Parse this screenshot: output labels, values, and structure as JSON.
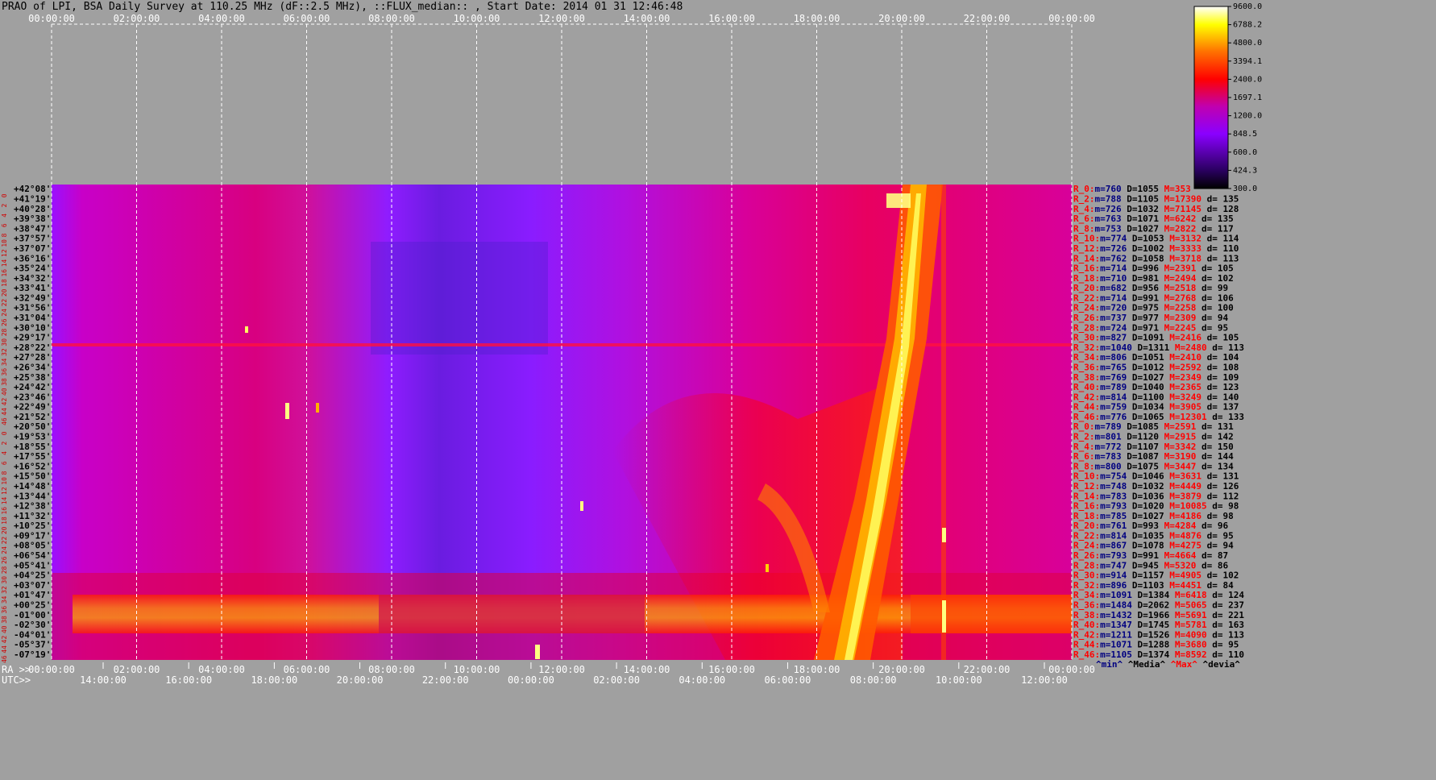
{
  "title": "PRAO of LPI, BSA Daily Survey at 110.25 MHz (dF::2.5 MHz), ::FLUX_median:: , Start Date: 2014 01 31 12:46:48",
  "chart_data": {
    "type": "heatmap",
    "title": "PRAO of LPI, BSA Daily Survey at 110.25 MHz (dF::2.5 MHz), ::FLUX_median:: , Start Date: 2014 01 31 12:46:48",
    "x_top_ticks": [
      "00:00:00",
      "02:00:00",
      "04:00:00",
      "06:00:00",
      "08:00:00",
      "10:00:00",
      "12:00:00",
      "14:00:00",
      "16:00:00",
      "18:00:00",
      "20:00:00",
      "22:00:00",
      "00:00:00"
    ],
    "x_top_label": "",
    "x_bottom_ra_prefix": "RA >>",
    "x_bottom_ra_ticks": [
      "00:00:00",
      "02:00:00",
      "04:00:00",
      "06:00:00",
      "08:00:00",
      "10:00:00",
      "12:00:00",
      "14:00:00",
      "16:00:00",
      "18:00:00",
      "20:00:00",
      "22:00:00",
      "00:00:00"
    ],
    "x_bottom_utc_prefix": "UTC>>",
    "x_bottom_utc_ticks": [
      "14:00:00",
      "16:00:00",
      "18:00:00",
      "20:00:00",
      "22:00:00",
      "00:00:00",
      "02:00:00",
      "04:00:00",
      "06:00:00",
      "08:00:00",
      "10:00:00",
      "12:00:00"
    ],
    "y_ticks": [
      "+42°08'",
      "+41°19'",
      "+40°28'",
      "+39°38'",
      "+38°47'",
      "+37°57'",
      "+37°07'",
      "+36°16'",
      "+35°24'",
      "+34°32'",
      "+33°41'",
      "+32°49'",
      "+31°56'",
      "+31°04'",
      "+30°10'",
      "+29°17'",
      "+28°22'",
      "+27°28'",
      "+26°34'",
      "+25°38'",
      "+24°42'",
      "+23°46'",
      "+22°49'",
      "+21°52'",
      "+20°50'",
      "+19°53'",
      "+18°55'",
      "+17°55'",
      "+16°52'",
      "+15°50'",
      "+14°48'",
      "+13°44'",
      "+12°38'",
      "+11°32'",
      "+10°25'",
      "+09°17'",
      "+08°05'",
      "+06°54'",
      "+05°41'",
      "+04°25'",
      "+03°07'",
      "+01°47'",
      "+00°25'",
      "-01°00'",
      "-02°30'",
      "-04°01'",
      "-05°37'",
      "-07°19'"
    ],
    "y_index_labels": [
      "0",
      "2",
      "4",
      "6",
      "8",
      "10",
      "12",
      "14",
      "16",
      "18",
      "20",
      "22",
      "24",
      "26",
      "28",
      "30",
      "32",
      "34",
      "36",
      "38",
      "40",
      "42",
      "44",
      "46",
      "0",
      "2",
      "4",
      "6",
      "8",
      "10",
      "12",
      "14",
      "16",
      "18",
      "20",
      "22",
      "24",
      "26",
      "28",
      "30",
      "32",
      "34",
      "36",
      "38",
      "40",
      "42",
      "44",
      "46"
    ],
    "colorbar": {
      "ticks": [
        9600.0,
        6788.2,
        4800.0,
        3394.1,
        2400.0,
        1697.1,
        1200.0,
        848.5,
        600.0,
        424.3,
        300.0
      ],
      "range": [
        300.0,
        9600.0
      ],
      "colors": [
        "#000000",
        "#3a0070",
        "#8a00ff",
        "#c000c0",
        "#ff0000",
        "#ff8000",
        "#ffff00",
        "#ffffff"
      ]
    },
    "stats_legend": {
      "min": "^min^",
      "median": "^Media^",
      "max": "^Max^",
      "dev": "^devia^"
    },
    "stats": [
      {
        "r": "R_0:",
        "m": "m=760",
        "D": "D=1055",
        "M": "M=353",
        "d": ""
      },
      {
        "r": "R_2:",
        "m": "m=788",
        "D": "D=1105",
        "M": "M=17390",
        "d": "d= 135"
      },
      {
        "r": "R_4:",
        "m": "m=726",
        "D": "D=1032",
        "M": "M=71145",
        "d": "d= 128"
      },
      {
        "r": "R_6:",
        "m": "m=763",
        "D": "D=1071",
        "M": "M=6242",
        "d": "d= 135"
      },
      {
        "r": "R_8:",
        "m": "m=753",
        "D": "D=1027",
        "M": "M=2822",
        "d": "d= 117"
      },
      {
        "r": "R_10:",
        "m": "m=774",
        "D": "D=1053",
        "M": "M=3132",
        "d": "d= 114"
      },
      {
        "r": "R_12:",
        "m": "m=726",
        "D": "D=1002",
        "M": "M=3333",
        "d": "d= 110"
      },
      {
        "r": "R_14:",
        "m": "m=762",
        "D": "D=1058",
        "M": "M=3718",
        "d": "d= 113"
      },
      {
        "r": "R_16:",
        "m": "m=714",
        "D": "D=996",
        "M": "M=2391",
        "d": "d= 105"
      },
      {
        "r": "R_18:",
        "m": "m=710",
        "D": "D=981",
        "M": "M=2494",
        "d": "d= 102"
      },
      {
        "r": "R_20:",
        "m": "m=682",
        "D": "D=956",
        "M": "M=2518",
        "d": "d= 99"
      },
      {
        "r": "R_22:",
        "m": "m=714",
        "D": "D=991",
        "M": "M=2768",
        "d": "d= 106"
      },
      {
        "r": "R_24:",
        "m": "m=720",
        "D": "D=975",
        "M": "M=2258",
        "d": "d= 100"
      },
      {
        "r": "R_26:",
        "m": "m=737",
        "D": "D=977",
        "M": "M=2309",
        "d": "d= 94"
      },
      {
        "r": "R_28:",
        "m": "m=724",
        "D": "D=971",
        "M": "M=2245",
        "d": "d= 95"
      },
      {
        "r": "R_30:",
        "m": "m=827",
        "D": "D=1091",
        "M": "M=2416",
        "d": "d= 105"
      },
      {
        "r": "R_32:",
        "m": "m=1040",
        "D": "D=1311",
        "M": "M=2480",
        "d": "d= 113"
      },
      {
        "r": "R_34:",
        "m": "m=806",
        "D": "D=1051",
        "M": "M=2410",
        "d": "d= 104"
      },
      {
        "r": "R_36:",
        "m": "m=765",
        "D": "D=1012",
        "M": "M=2592",
        "d": "d= 108"
      },
      {
        "r": "R_38:",
        "m": "m=769",
        "D": "D=1027",
        "M": "M=2349",
        "d": "d= 109"
      },
      {
        "r": "R_40:",
        "m": "m=789",
        "D": "D=1040",
        "M": "M=2365",
        "d": "d= 123"
      },
      {
        "r": "R_42:",
        "m": "m=814",
        "D": "D=1100",
        "M": "M=3249",
        "d": "d= 140"
      },
      {
        "r": "R_44:",
        "m": "m=759",
        "D": "D=1034",
        "M": "M=3905",
        "d": "d= 137"
      },
      {
        "r": "R_46:",
        "m": "m=776",
        "D": "D=1065",
        "M": "M=12301",
        "d": "d= 133"
      },
      {
        "r": "R_0:",
        "m": "m=789",
        "D": "D=1085",
        "M": "M=2591",
        "d": "d= 131"
      },
      {
        "r": "R_2:",
        "m": "m=801",
        "D": "D=1120",
        "M": "M=2915",
        "d": "d= 142"
      },
      {
        "r": "R_4:",
        "m": "m=772",
        "D": "D=1107",
        "M": "M=3342",
        "d": "d= 150"
      },
      {
        "r": "R_6:",
        "m": "m=783",
        "D": "D=1087",
        "M": "M=3190",
        "d": "d= 144"
      },
      {
        "r": "R_8:",
        "m": "m=800",
        "D": "D=1075",
        "M": "M=3447",
        "d": "d= 134"
      },
      {
        "r": "R_10:",
        "m": "m=754",
        "D": "D=1046",
        "M": "M=3631",
        "d": "d= 131"
      },
      {
        "r": "R_12:",
        "m": "m=748",
        "D": "D=1032",
        "M": "M=4449",
        "d": "d= 126"
      },
      {
        "r": "R_14:",
        "m": "m=783",
        "D": "D=1036",
        "M": "M=3879",
        "d": "d= 112"
      },
      {
        "r": "R_16:",
        "m": "m=793",
        "D": "D=1020",
        "M": "M=10085",
        "d": "d= 98"
      },
      {
        "r": "R_18:",
        "m": "m=785",
        "D": "D=1027",
        "M": "M=4186",
        "d": "d= 98"
      },
      {
        "r": "R_20:",
        "m": "m=761",
        "D": "D=993",
        "M": "M=4284",
        "d": "d= 96"
      },
      {
        "r": "R_22:",
        "m": "m=814",
        "D": "D=1035",
        "M": "M=4876",
        "d": "d= 95"
      },
      {
        "r": "R_24:",
        "m": "m=867",
        "D": "D=1078",
        "M": "M=4275",
        "d": "d= 94"
      },
      {
        "r": "R_26:",
        "m": "m=793",
        "D": "D=991",
        "M": "M=4664",
        "d": "d= 87"
      },
      {
        "r": "R_28:",
        "m": "m=747",
        "D": "D=945",
        "M": "M=5320",
        "d": "d= 86"
      },
      {
        "r": "R_30:",
        "m": "m=914",
        "D": "D=1157",
        "M": "M=4905",
        "d": "d= 102"
      },
      {
        "r": "R_32:",
        "m": "m=896",
        "D": "D=1103",
        "M": "M=4451",
        "d": "d= 84"
      },
      {
        "r": "R_34:",
        "m": "m=1091",
        "D": "D=1384",
        "M": "M=6418",
        "d": "d= 124"
      },
      {
        "r": "R_36:",
        "m": "m=1484",
        "D": "D=2062",
        "M": "M=5065",
        "d": "d= 237"
      },
      {
        "r": "R_38:",
        "m": "m=1432",
        "D": "D=1966",
        "M": "M=5691",
        "d": "d= 221"
      },
      {
        "r": "R_40:",
        "m": "m=1347",
        "D": "D=1745",
        "M": "M=5781",
        "d": "d= 163"
      },
      {
        "r": "R_42:",
        "m": "m=1211",
        "D": "D=1526",
        "M": "M=4090",
        "d": "d= 113"
      },
      {
        "r": "R_44:",
        "m": "m=1071",
        "D": "D=1288",
        "M": "M=3680",
        "d": "d= 95"
      },
      {
        "r": "R_46:",
        "m": "m=1105",
        "D": "D=1374",
        "M": "M=8592",
        "d": "d= 110"
      }
    ],
    "colors": {
      "background": "#a0a0a0",
      "grid": "#ffffff",
      "tick_red": "#d00000",
      "stat_m": "#000080",
      "stat_D": "#000000",
      "stat_M": "#ff0000",
      "stat_d": "#000000"
    }
  }
}
